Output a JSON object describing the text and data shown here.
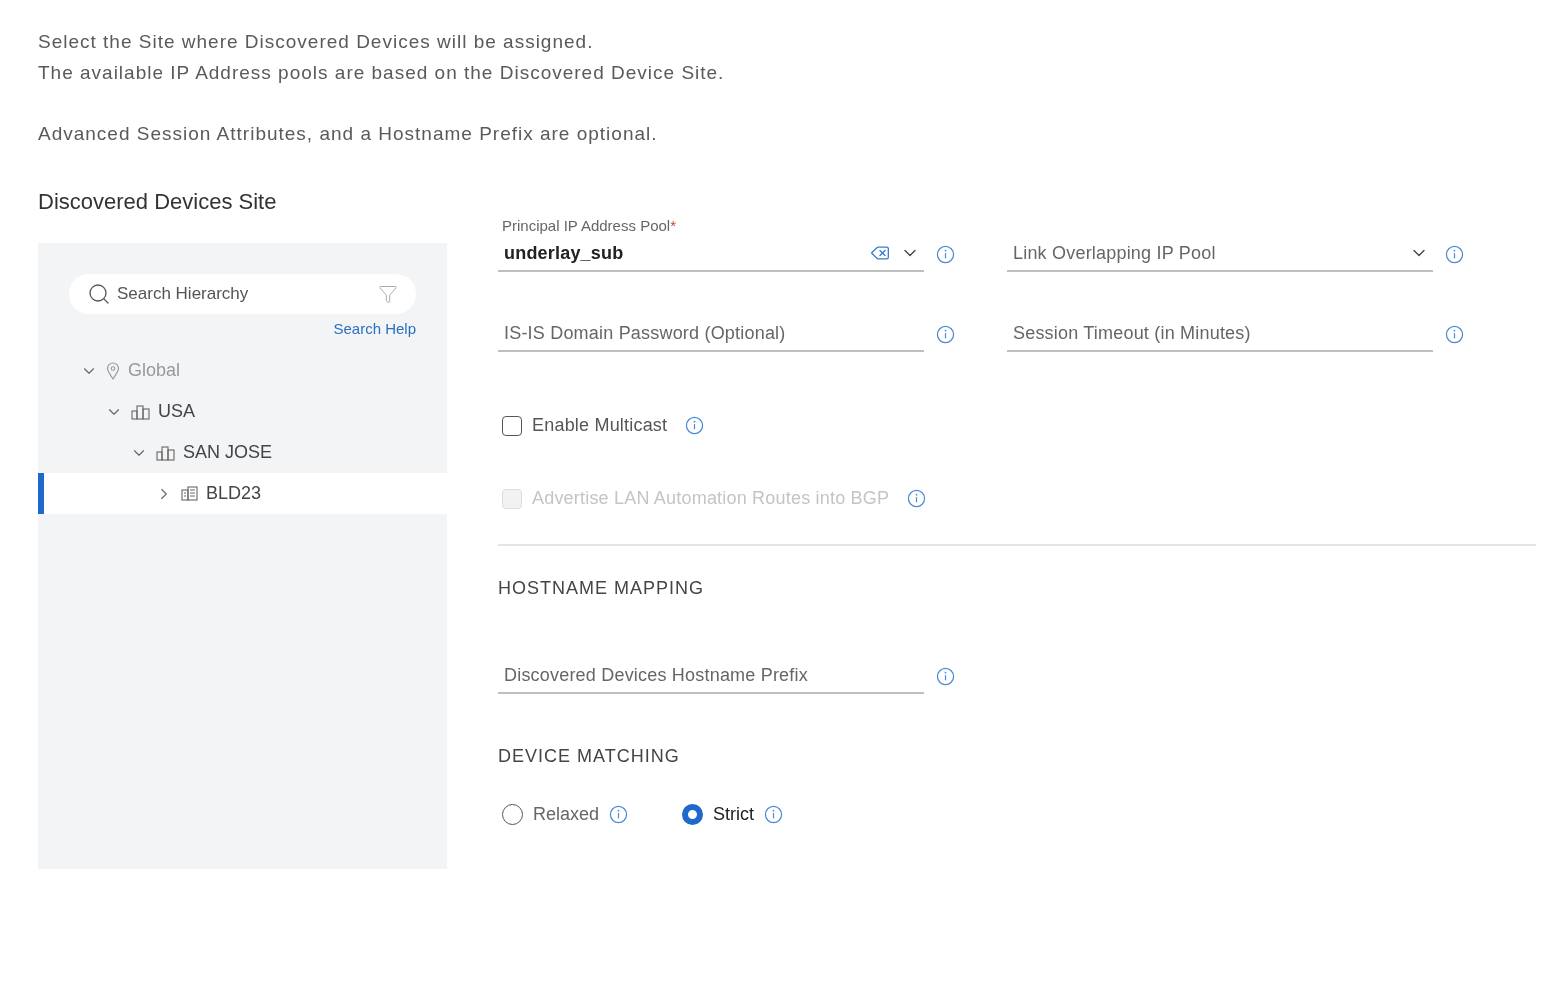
{
  "intro": [
    "Select the Site where Discovered Devices will be assigned.",
    "The available IP Address pools are based on the Discovered Device Site.",
    "Advanced Session Attributes, and a Hostname Prefix are optional."
  ],
  "site_panel": {
    "title": "Discovered Devices Site",
    "search": {
      "placeholder": "Search Hierarchy"
    },
    "search_help": "Search Help",
    "tree": [
      {
        "label": "Global",
        "kind": "pin",
        "expanded": true,
        "selected": false,
        "disabled": true,
        "children": [
          {
            "label": "USA",
            "kind": "area",
            "expanded": true,
            "selected": false,
            "disabled": false,
            "children": [
              {
                "label": "SAN JOSE",
                "kind": "area",
                "expanded": true,
                "selected": false,
                "disabled": false,
                "children": [
                  {
                    "label": "BLD23",
                    "kind": "building",
                    "expanded": false,
                    "selected": true,
                    "disabled": false
                  }
                ]
              }
            ]
          }
        ]
      }
    ]
  },
  "fields": [
    {
      "kind": "select",
      "label": "Principal IP Address Pool",
      "required_mark": "*",
      "value": "underlay_sub",
      "clearable": true
    },
    {
      "kind": "select",
      "placeholder": "Link Overlapping IP Pool"
    },
    {
      "kind": "text",
      "placeholder": "IS-IS Domain Password (Optional)"
    },
    {
      "kind": "text",
      "placeholder": "Session Timeout (in Minutes)"
    }
  ],
  "checkboxes": [
    {
      "label": "Enable Multicast",
      "checked": false,
      "disabled": false
    },
    {
      "label": "Advertise LAN Automation Routes into BGP",
      "checked": false,
      "disabled": true
    }
  ],
  "hostname_mapping": {
    "heading": "HOSTNAME MAPPING",
    "field": {
      "placeholder": "Discovered Devices Hostname Prefix"
    }
  },
  "device_matching": {
    "heading": "DEVICE MATCHING",
    "options": [
      {
        "label": "Relaxed",
        "selected": false
      },
      {
        "label": "Strict",
        "selected": true
      }
    ]
  }
}
